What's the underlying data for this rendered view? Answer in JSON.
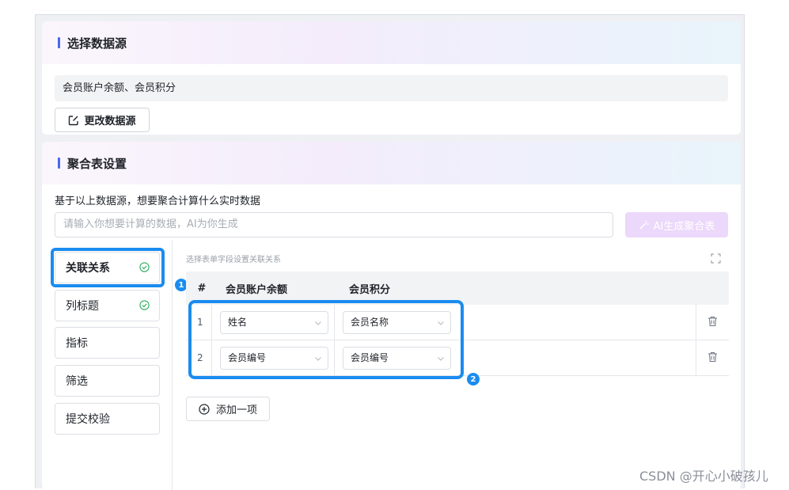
{
  "datasource": {
    "title": "选择数据源",
    "selected": "会员账户余额、会员积分",
    "change_label": "更改数据源"
  },
  "aggregate": {
    "title": "聚合表设置",
    "description": "基于以上数据源，想要聚合计算什么实时数据",
    "ai_placeholder": "请输入你想要计算的数据，AI为你生成",
    "ai_button": "AI生成聚合表"
  },
  "sidebar": {
    "items": [
      {
        "label": "关联关系",
        "checked": true
      },
      {
        "label": "列标题",
        "checked": true
      },
      {
        "label": "指标"
      },
      {
        "label": "筛选"
      },
      {
        "label": "提交校验"
      }
    ]
  },
  "relation": {
    "hint": "选择表单字段设置关联关系",
    "columns": [
      "#",
      "会员账户余额",
      "会员积分"
    ],
    "rows": [
      {
        "index": "1",
        "left": "姓名",
        "right": "会员名称"
      },
      {
        "index": "2",
        "left": "会员编号",
        "right": "会员编号"
      }
    ],
    "add_label": "添加一项"
  },
  "badges": [
    "1",
    "2"
  ],
  "watermark": "CSDN @开心小破孩儿",
  "colors": {
    "accent": "#4a67f0",
    "highlight": "#1a8cf0",
    "success": "#2bae5b",
    "ai_button": "#ecd8fb"
  }
}
